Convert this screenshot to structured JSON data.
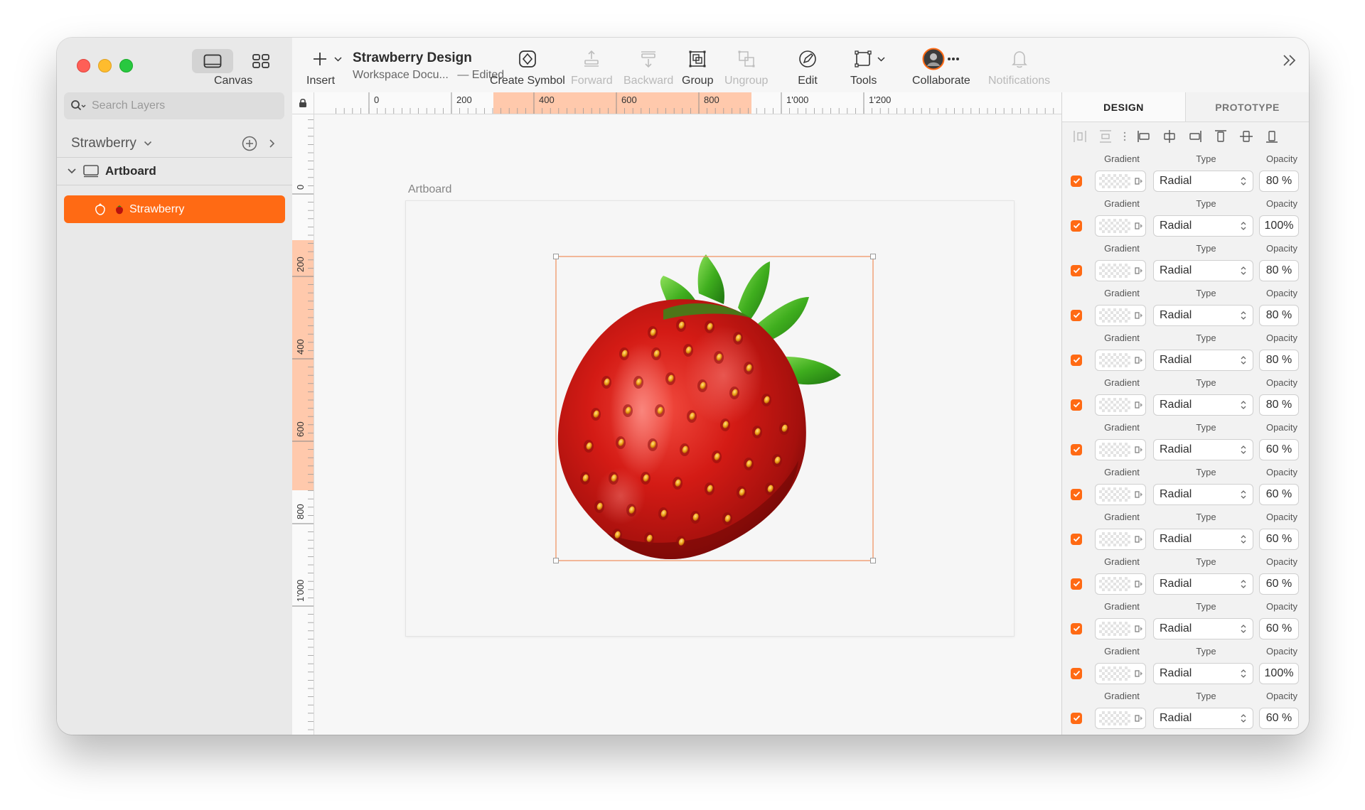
{
  "sidebar": {
    "canvas_label": "Canvas",
    "search_placeholder": "Search Layers",
    "page_name": "Strawberry",
    "artboard_label": "Artboard",
    "selected_layer": "Strawberry"
  },
  "toolbar": {
    "insert": "Insert",
    "doc_title": "Strawberry Design",
    "doc_subtitle": "Workspace Docu...",
    "doc_status": "— Edited",
    "create_symbol": "Create Symbol",
    "forward": "Forward",
    "backward": "Backward",
    "group": "Group",
    "ungroup": "Ungroup",
    "edit": "Edit",
    "tools": "Tools",
    "collaborate": "Collaborate",
    "notifications": "Notifications"
  },
  "rulers": {
    "top_ticks": [
      "0",
      "200",
      "400",
      "600",
      "800",
      "1'000",
      "1'200"
    ],
    "left_ticks": [
      "0",
      "200",
      "400",
      "600",
      "800",
      "1'000"
    ]
  },
  "canvas": {
    "artboard_title": "Artboard"
  },
  "inspector": {
    "tabs": [
      "DESIGN",
      "PROTOTYPE"
    ],
    "headers": {
      "gradient": "Gradient",
      "type": "Type",
      "opacity": "Opacity"
    },
    "fills": [
      {
        "type": "Radial",
        "opacity": "80 %"
      },
      {
        "type": "Radial",
        "opacity": "100%"
      },
      {
        "type": "Radial",
        "opacity": "80 %"
      },
      {
        "type": "Radial",
        "opacity": "80 %"
      },
      {
        "type": "Radial",
        "opacity": "80 %"
      },
      {
        "type": "Radial",
        "opacity": "80 %"
      },
      {
        "type": "Radial",
        "opacity": "60 %"
      },
      {
        "type": "Radial",
        "opacity": "60 %"
      },
      {
        "type": "Radial",
        "opacity": "60 %"
      },
      {
        "type": "Radial",
        "opacity": "60 %"
      },
      {
        "type": "Radial",
        "opacity": "60 %"
      },
      {
        "type": "Radial",
        "opacity": "100%"
      },
      {
        "type": "Radial",
        "opacity": "60 %"
      }
    ]
  },
  "colors": {
    "accent": "#ff6a14",
    "strawberry_red": "#d01a14",
    "leaf_green": "#3fae1e"
  }
}
